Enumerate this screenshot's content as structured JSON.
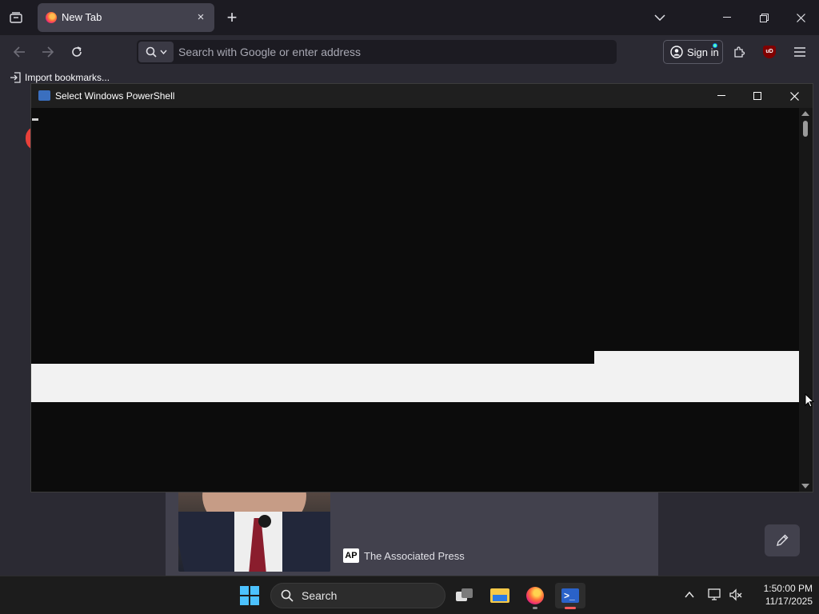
{
  "browser": {
    "tab": {
      "title": "New Tab",
      "close": "×"
    },
    "new_tab": "+",
    "urlbar": {
      "placeholder": "Search with Google or enter address"
    },
    "signin_label": "Sign in",
    "extension_label": "uD",
    "bookmarks": {
      "import_label": "Import bookmarks..."
    }
  },
  "powershell": {
    "title": "Select Windows PowerShell"
  },
  "newtab": {
    "story": {
      "source": "The Associated Press",
      "source_logo": "AP"
    }
  },
  "taskbar": {
    "search_label": "Search",
    "time": "1:50:00 PM",
    "date": "11/17/2025"
  },
  "colors": {
    "accent": "#4cc2ff",
    "console_bg": "#0c0c0c",
    "selection": "#f2f2f2"
  }
}
